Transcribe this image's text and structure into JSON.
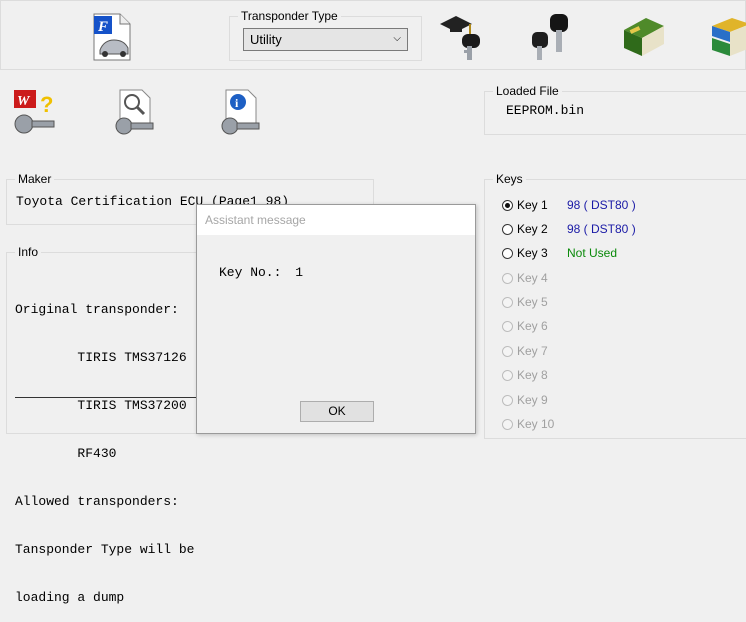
{
  "transponder": {
    "label": "Transponder Type",
    "selected": "Utility"
  },
  "loaded_file": {
    "label": "Loaded File",
    "value": "EEPROM.bin"
  },
  "maker": {
    "label": "Maker",
    "value": "Toyota Certification ECU (Page1 98)"
  },
  "info": {
    "label": "Info",
    "lines": [
      "Original transponder:",
      "        TIRIS TMS37126",
      "        TIRIS TMS37200",
      "        RF430",
      "Allowed transponders:",
      "Tansponder Type will be",
      "loading a dump"
    ]
  },
  "keys": {
    "label": "Keys",
    "items": [
      {
        "label": "Key 1",
        "value": "98 ( DST80 )",
        "checked": true,
        "enabled": true
      },
      {
        "label": "Key 2",
        "value": "98 ( DST80 )",
        "checked": false,
        "enabled": true
      },
      {
        "label": "Key 3",
        "value": "Not Used",
        "checked": false,
        "enabled": true
      },
      {
        "label": "Key 4",
        "value": "",
        "checked": false,
        "enabled": false
      },
      {
        "label": "Key 5",
        "value": "",
        "checked": false,
        "enabled": false
      },
      {
        "label": "Key 6",
        "value": "",
        "checked": false,
        "enabled": false
      },
      {
        "label": "Key 7",
        "value": "",
        "checked": false,
        "enabled": false
      },
      {
        "label": "Key 8",
        "value": "",
        "checked": false,
        "enabled": false
      },
      {
        "label": "Key 9",
        "value": "",
        "checked": false,
        "enabled": false
      },
      {
        "label": "Key 10",
        "value": "",
        "checked": false,
        "enabled": false
      }
    ]
  },
  "dialog": {
    "title": "Assistant message",
    "message_label": "Key No.:",
    "message_value": "1",
    "ok_label": "OK"
  },
  "colors": {
    "key_value_blue": "#1a1aa6",
    "not_used_green": "#0a8a0a"
  }
}
